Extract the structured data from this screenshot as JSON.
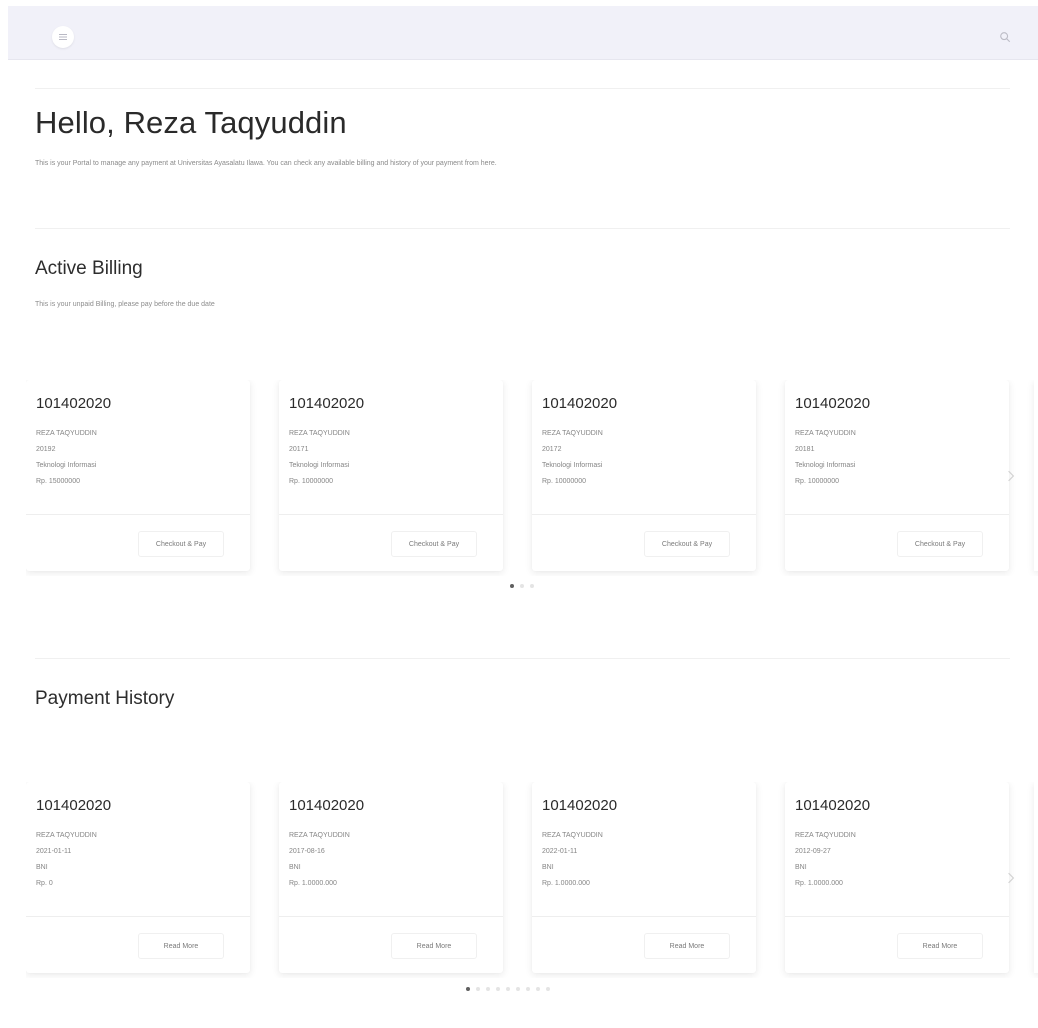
{
  "header": {
    "menu_icon": "menu-icon",
    "search_icon": "search-icon"
  },
  "greeting": {
    "title": "Hello, Reza Taqyuddin",
    "intro": "This is your Portal to manage any payment at Universitas Ayasalatu Ilawa. You can check any available billing and history of your payment from here."
  },
  "active_billing": {
    "title": "Active Billing",
    "subtitle": "This is your unpaid Billing, please pay before the due date",
    "cards": [
      {
        "code": "101402020",
        "name": "REZA TAQYUDDIN",
        "ref": "20192",
        "dept": "Teknologi Informasi",
        "amount": "Rp. 15000000",
        "button": "Checkout & Pay"
      },
      {
        "code": "101402020",
        "name": "REZA TAQYUDDIN",
        "ref": "20171",
        "dept": "Teknologi Informasi",
        "amount": "Rp. 10000000",
        "button": "Checkout & Pay"
      },
      {
        "code": "101402020",
        "name": "REZA TAQYUDDIN",
        "ref": "20172",
        "dept": "Teknologi Informasi",
        "amount": "Rp. 10000000",
        "button": "Checkout & Pay"
      },
      {
        "code": "101402020",
        "name": "REZA TAQYUDDIN",
        "ref": "20181",
        "dept": "Teknologi Informasi",
        "amount": "Rp. 10000000",
        "button": "Checkout & Pay"
      }
    ],
    "dots_total": 3,
    "dots_active": 0
  },
  "payment_history": {
    "title": "Payment History",
    "cards": [
      {
        "code": "101402020",
        "name": "REZA TAQYUDDIN",
        "date": "2021-01-11",
        "method": "BNI",
        "amount": "Rp. 0",
        "button": "Read More"
      },
      {
        "code": "101402020",
        "name": "REZA TAQYUDDIN",
        "date": "2017-08-16",
        "method": "BNI",
        "amount": "Rp. 1.0000.000",
        "button": "Read More"
      },
      {
        "code": "101402020",
        "name": "REZA TAQYUDDIN",
        "date": "2022-01-11",
        "method": "BNI",
        "amount": "Rp. 1.0000.000",
        "button": "Read More"
      },
      {
        "code": "101402020",
        "name": "REZA TAQYUDDIN",
        "date": "2012-09-27",
        "method": "BNI",
        "amount": "Rp. 1.0000.000",
        "button": "Read More"
      }
    ],
    "dots_total": 9,
    "dots_active": 0
  },
  "colors": {
    "header_bg": "#f1f1f9",
    "dot_active": "#5f5f5f",
    "dot_inactive": "#e4e4e4"
  }
}
